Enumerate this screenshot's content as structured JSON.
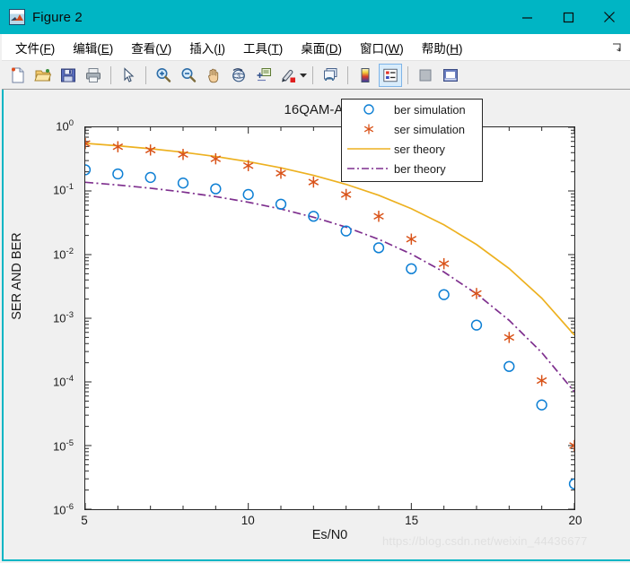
{
  "window": {
    "title": "Figure 2",
    "icon": "matlab-logo-icon",
    "titlebar_color": "#00b5c4",
    "buttons": {
      "minimize": "minimize-icon",
      "maximize": "maximize-icon",
      "close": "close-icon"
    }
  },
  "menubar": {
    "items": [
      {
        "label": "文件(F)",
        "text": "文件(",
        "mnemonic": "F",
        "tail": ")"
      },
      {
        "label": "编辑(E)",
        "text": "编辑(",
        "mnemonic": "E",
        "tail": ")"
      },
      {
        "label": "查看(V)",
        "text": "查看(",
        "mnemonic": "V",
        "tail": ")"
      },
      {
        "label": "插入(I)",
        "text": "插入(",
        "mnemonic": "I",
        "tail": ")"
      },
      {
        "label": "工具(T)",
        "text": "工具(",
        "mnemonic": "T",
        "tail": ")"
      },
      {
        "label": "桌面(D)",
        "text": "桌面(",
        "mnemonic": "D",
        "tail": ")"
      },
      {
        "label": "窗口(W)",
        "text": "窗口(",
        "mnemonic": "W",
        "tail": ")"
      },
      {
        "label": "帮助(H)",
        "text": "帮助(",
        "mnemonic": "H",
        "tail": ")"
      }
    ],
    "dock_icon": "dock-arrow-icon"
  },
  "toolbar": {
    "items": [
      {
        "name": "new-figure-button",
        "icon": "new-document-icon"
      },
      {
        "name": "open-file-button",
        "icon": "open-folder-icon"
      },
      {
        "name": "save-figure-button",
        "icon": "save-disk-icon"
      },
      {
        "name": "print-figure-button",
        "icon": "printer-icon"
      },
      {
        "name": "separator-1",
        "icon": "separator"
      },
      {
        "name": "edit-plot-button",
        "icon": "arrow-pointer-icon"
      },
      {
        "name": "separator-2",
        "icon": "separator"
      },
      {
        "name": "zoom-in-button",
        "icon": "magnifier-plus-icon"
      },
      {
        "name": "zoom-out-button",
        "icon": "magnifier-minus-icon"
      },
      {
        "name": "pan-button",
        "icon": "hand-icon"
      },
      {
        "name": "rotate-3d-button",
        "icon": "rotate-3d-icon"
      },
      {
        "name": "data-cursor-button",
        "icon": "data-cursor-icon"
      },
      {
        "name": "brush-button",
        "icon": "brush-icon"
      },
      {
        "name": "brush-dropdown",
        "icon": "caret-down-icon"
      },
      {
        "name": "separator-3",
        "icon": "separator"
      },
      {
        "name": "link-data-button",
        "icon": "link-data-icon"
      },
      {
        "name": "separator-4",
        "icon": "separator"
      },
      {
        "name": "colorbar-button",
        "icon": "colorbar-icon"
      },
      {
        "name": "legend-button",
        "icon": "legend-icon",
        "active": true
      },
      {
        "name": "separator-5",
        "icon": "separator"
      },
      {
        "name": "hide-plot-tools-button",
        "icon": "hide-plot-tools-icon"
      },
      {
        "name": "show-plot-tools-button",
        "icon": "show-plot-tools-icon"
      }
    ]
  },
  "chart_data": {
    "type": "line",
    "title": "16QAM-AWGN",
    "xlabel": "Es/N0",
    "ylabel": "SER AND BER",
    "xscale": "linear",
    "yscale": "log",
    "xlim": [
      5,
      20
    ],
    "ylim": [
      1e-06,
      1
    ],
    "xticks": [
      5,
      10,
      15,
      20
    ],
    "xticklabels": [
      "5",
      "10",
      "15",
      "20"
    ],
    "yticks": [
      1e-06,
      1e-05,
      0.0001,
      0.001,
      0.01,
      0.1,
      1
    ],
    "yticklabels": [
      "10-6",
      "10-5",
      "10-4",
      "10-3",
      "10-2",
      "10-1",
      "100"
    ],
    "ytick_mantissa": "10",
    "ytick_exponents": [
      "-6",
      "-5",
      "-4",
      "-3",
      "-2",
      "-1",
      "0"
    ],
    "grid": false,
    "legend_position": "upper right",
    "x": [
      5,
      6,
      7,
      8,
      9,
      10,
      11,
      12,
      13,
      14,
      15,
      16,
      17,
      18,
      19,
      20
    ],
    "series": [
      {
        "name": "ber simulation",
        "label": "ber simulation",
        "style": "marker",
        "marker": "circle",
        "color": "#0d7fd4",
        "values": [
          0.215,
          0.185,
          0.163,
          0.133,
          0.108,
          0.088,
          0.062,
          0.04,
          0.0235,
          0.0128,
          0.006,
          0.00235,
          0.00078,
          0.000175,
          4.35e-05,
          2.5e-06
        ]
      },
      {
        "name": "ser simulation",
        "label": "ser simulation",
        "style": "marker",
        "marker": "asterisk",
        "color": "#d95319",
        "values": [
          0.555,
          0.495,
          0.44,
          0.375,
          0.32,
          0.25,
          0.19,
          0.138,
          0.088,
          0.04,
          0.0175,
          0.0072,
          0.00245,
          0.0005,
          0.000105,
          1e-05
        ]
      },
      {
        "name": "ser theory",
        "label": "ser theory",
        "style": "line",
        "linestyle": "solid",
        "color": "#edb120",
        "values": [
          0.56,
          0.512,
          0.461,
          0.406,
          0.348,
          0.289,
          0.231,
          0.176,
          0.127,
          0.0855,
          0.0527,
          0.0294,
          0.0144,
          0.00604,
          0.00207,
          0.000545
        ]
      },
      {
        "name": "ber theory",
        "label": "ber theory",
        "style": "line",
        "linestyle": "dashdot",
        "color": "#7e2f8e",
        "values": [
          0.137,
          0.124,
          0.1105,
          0.0962,
          0.0815,
          0.0666,
          0.0521,
          0.0387,
          0.027,
          0.0174,
          0.0102,
          0.00533,
          0.00242,
          0.000928,
          0.000289,
          7e-05
        ]
      }
    ],
    "watermark": "https://blog.csdn.net/weixin_44436677"
  }
}
